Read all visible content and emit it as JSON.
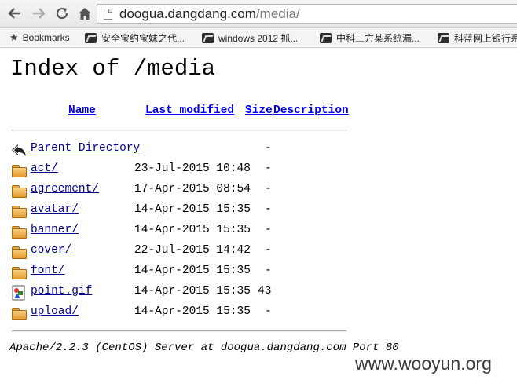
{
  "browser": {
    "url_host": "doogua.dangdang.com",
    "url_path": "/media/",
    "bookmarks_label": "Bookmarks",
    "bookmarks": [
      "安全宝约宝妹之代...",
      "windows 2012 抓...",
      "中科三方某系统漏...",
      "科蓝网上银行系"
    ]
  },
  "page": {
    "title": "Index of /media",
    "columns": {
      "name": "Name",
      "last_modified": "Last modified",
      "size": "Size",
      "description": "Description"
    },
    "parent": {
      "name": "Parent Directory",
      "size": "-"
    },
    "entries": [
      {
        "name": "act/",
        "modified": "23-Jul-2015 10:48",
        "size": "-",
        "icon": "folder-icon"
      },
      {
        "name": "agreement/",
        "modified": "17-Apr-2015 08:54",
        "size": "-",
        "icon": "folder-icon"
      },
      {
        "name": "avatar/",
        "modified": "14-Apr-2015 15:35",
        "size": "-",
        "icon": "folder-icon"
      },
      {
        "name": "banner/",
        "modified": "14-Apr-2015 15:35",
        "size": "-",
        "icon": "folder-icon"
      },
      {
        "name": "cover/",
        "modified": "22-Jul-2015 14:42",
        "size": "-",
        "icon": "folder-icon"
      },
      {
        "name": "font/",
        "modified": "14-Apr-2015 15:35",
        "size": "-",
        "icon": "folder-icon"
      },
      {
        "name": "point.gif",
        "modified": "14-Apr-2015 15:35",
        "size": "43",
        "icon": "image-file-icon"
      },
      {
        "name": "upload/",
        "modified": "14-Apr-2015 15:35",
        "size": "-",
        "icon": "folder-icon"
      }
    ],
    "footer": "Apache/2.2.3 (CentOS) Server at doogua.dangdang.com Port 80"
  },
  "watermark": "www.wooyun.org"
}
